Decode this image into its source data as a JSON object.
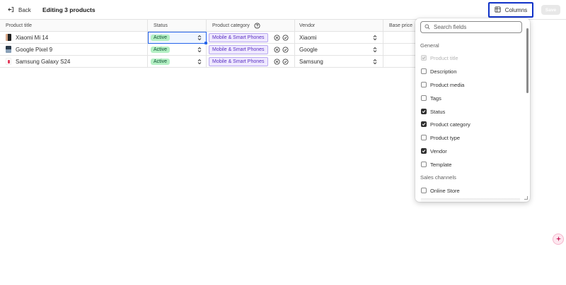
{
  "topbar": {
    "back_label": "Back",
    "title": "Editing 3 products",
    "columns_label": "Columns",
    "save_label": "Save"
  },
  "table": {
    "headers": {
      "title": "Product title",
      "status": "Status",
      "category": "Product category",
      "vendor": "Vendor",
      "price": "Base price"
    },
    "rows": [
      {
        "title": "Xiaomi Mi 14",
        "status": "Active",
        "category": "Mobile & Smart Phones",
        "vendor": "Xiaomi",
        "thumb": "xiaomi-thumb"
      },
      {
        "title": "Google Pixel 9",
        "status": "Active",
        "category": "Mobile & Smart Phones",
        "vendor": "Google",
        "thumb": "pixel-thumb"
      },
      {
        "title": "Samsung Galaxy S24",
        "status": "Active",
        "category": "Mobile & Smart Phones",
        "vendor": "Samsung",
        "thumb": "samsung-thumb"
      }
    ]
  },
  "columns_popover": {
    "search_placeholder": "Search fields",
    "sections": {
      "general": "General",
      "sales_channels": "Sales channels"
    },
    "options": [
      {
        "label": "Product title",
        "checked": true,
        "disabled": true
      },
      {
        "label": "Description",
        "checked": false,
        "disabled": false
      },
      {
        "label": "Product media",
        "checked": false,
        "disabled": false
      },
      {
        "label": "Tags",
        "checked": false,
        "disabled": false
      },
      {
        "label": "Status",
        "checked": true,
        "disabled": false
      },
      {
        "label": "Product category",
        "checked": true,
        "disabled": false
      },
      {
        "label": "Product type",
        "checked": false,
        "disabled": false
      },
      {
        "label": "Vendor",
        "checked": true,
        "disabled": false
      },
      {
        "label": "Template",
        "checked": false,
        "disabled": false
      }
    ],
    "sales_channel_options": [
      {
        "label": "Online Store",
        "checked": false,
        "disabled": false
      }
    ]
  },
  "colors": {
    "accent": "#1032c8",
    "status_active_bg": "#b4f0c4",
    "category_tag_bg": "#efe9ff",
    "selection": "#2463eb"
  }
}
